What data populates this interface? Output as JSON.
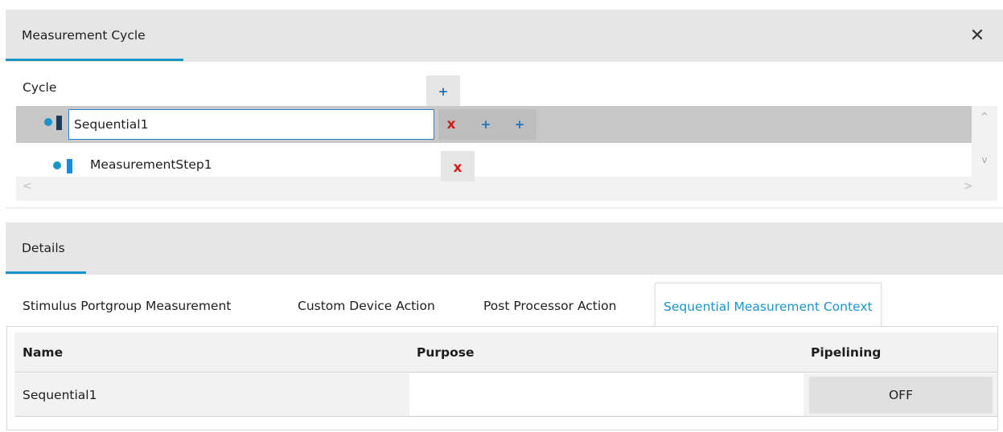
{
  "panel": {
    "title": "Measurement Cycle",
    "close_label": "✕"
  },
  "cycle": {
    "label": "Cycle",
    "add_label": "+",
    "nodes": [
      {
        "name": "Sequential1",
        "delete_label": "x",
        "add_labels": [
          "+",
          "+"
        ],
        "bar_color": "#1b3a5c"
      },
      {
        "name": "MeasurementStep1",
        "delete_label": "x",
        "bar_color": "#1a8be0"
      }
    ],
    "scroll": {
      "up": "^",
      "down": "v",
      "left": "<",
      "right": ">"
    }
  },
  "details": {
    "title": "Details",
    "tabs": [
      "Stimulus Portgroup Measurement",
      "Custom Device Action",
      "Post Processor Action",
      "Sequential Measurement Context"
    ],
    "active_tab": "Sequential Measurement Context",
    "table": {
      "columns": [
        "Name",
        "Purpose",
        "Pipelining"
      ],
      "rows": [
        {
          "name": "Sequential1",
          "purpose": "",
          "pipelining": "OFF"
        }
      ]
    }
  },
  "colors": {
    "accent": "#1a95c9",
    "delete": "#d21c1c",
    "add": "#1f72b8"
  }
}
